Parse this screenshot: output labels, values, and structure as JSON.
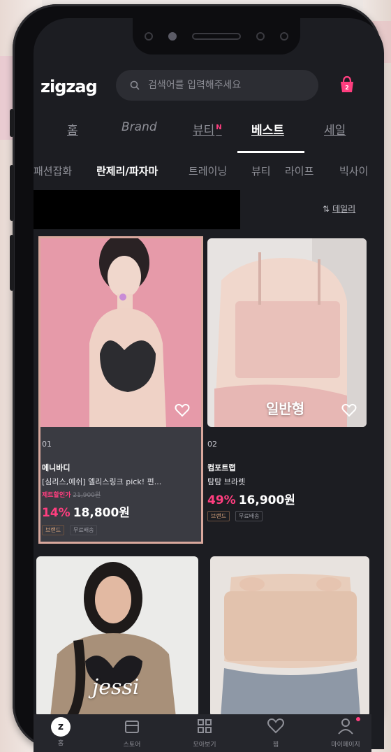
{
  "app": {
    "logo": "zigzag"
  },
  "search": {
    "placeholder": "검색어를 입력해주세요"
  },
  "main_tabs": [
    {
      "label": "홈",
      "active": false
    },
    {
      "label": "Brand",
      "active": false
    },
    {
      "label": "뷰티",
      "badge": "N",
      "active": false
    },
    {
      "label": "베스트",
      "active": true
    },
    {
      "label": "세일",
      "active": false
    }
  ],
  "categories": [
    {
      "label": "패션잡화",
      "active": false
    },
    {
      "label": "란제리/파자마",
      "active": true
    },
    {
      "label": "트레이닝",
      "active": false
    },
    {
      "label": "뷰티",
      "active": false
    },
    {
      "label": "라이프",
      "active": false
    },
    {
      "label": "빅사이",
      "active": false
    }
  ],
  "sort": {
    "label": "데일리"
  },
  "products": [
    {
      "rank": "01",
      "store": "메니바디",
      "name": "[심리스,예쉬] 엘리스링크 pick! 편...",
      "promo_label": "제트할인가",
      "original_price": "21,900원",
      "discount": "14%",
      "price": "18,800원",
      "tags": [
        "브랜드",
        "무료배송"
      ]
    },
    {
      "rank": "02",
      "store": "컴포트랩",
      "name": "탐탐 브라렛",
      "overlay": "일반형",
      "discount": "49%",
      "price": "16,900원",
      "tags": [
        "브랜드",
        "무료배송"
      ]
    },
    {
      "overlay": "jessi"
    },
    {}
  ],
  "bottom_nav": [
    {
      "label": "홈",
      "icon": "home-z-icon"
    },
    {
      "label": "스토어",
      "icon": "store-icon"
    },
    {
      "label": "모아보기",
      "icon": "grid-icon"
    },
    {
      "label": "찜",
      "icon": "heart-icon"
    },
    {
      "label": "마이페이지",
      "icon": "person-icon"
    }
  ],
  "colors": {
    "accent": "#ff3e7f",
    "background": "#1c1d22",
    "selection_border": "#d9a89d"
  }
}
